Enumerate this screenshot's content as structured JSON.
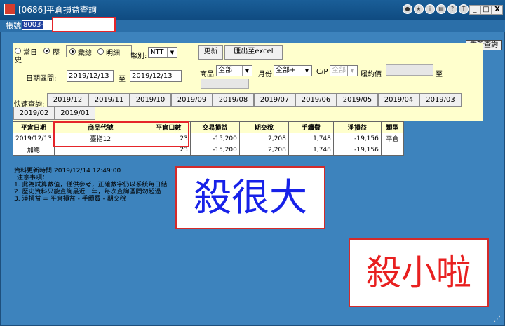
{
  "window": {
    "title": "[0686]平倉損益查詢",
    "minimize": "_",
    "maximize": "□",
    "close": "X"
  },
  "titlebar_icons": [
    "user-icon",
    "star-icon",
    "info-icon",
    "print-icon",
    "help-icon",
    "question-icon"
  ],
  "account": {
    "label": "帳號",
    "value": "8003-006"
  },
  "requery_button": "重新查詢",
  "filters": {
    "today_label": "當日",
    "history_label": "歷",
    "history_label2": "史",
    "total_label": "彙總",
    "detail_label": "明細",
    "currency_label": "幣別:",
    "currency_value": "NTT",
    "refresh_button": "更新",
    "export_button": "匯出至excel",
    "date_range_label": "日期區間:",
    "date_from": "2019/12/13",
    "date_to_label": "至",
    "date_to": "2019/12/13",
    "product_label": "商品",
    "product_value": "全部",
    "month_label": "月份",
    "month_value": "全部+",
    "cp_label": "C/P",
    "cp_value": "全部",
    "strike_label": "履約價",
    "strike_to_label": "至",
    "quick_query_label": "快速查詢:",
    "quick_months": [
      "2019/12",
      "2019/11",
      "2019/10",
      "2019/09",
      "2019/08",
      "2019/07",
      "2019/06",
      "2019/05",
      "2019/04",
      "2019/03",
      "2019/02",
      "2019/01"
    ]
  },
  "table": {
    "headers": [
      "平倉日期",
      "商品代號",
      "平倉口數",
      "交易損益",
      "期交稅",
      "手續費",
      "淨損益",
      "類型"
    ],
    "rows": [
      [
        "2019/12/13",
        "臺指12",
        "23",
        "-15,200",
        "2,208",
        "1,748",
        "-19,156",
        "平倉"
      ]
    ],
    "total_row": [
      "加總",
      "",
      "23",
      "-15,200",
      "2,208",
      "1,748",
      "-19,156",
      ""
    ]
  },
  "notes": {
    "updated": "資料更新時間:2019/12/14 12:49:00",
    "heading": "注意事項：",
    "line1": "1. 此為試算數值，僅供參考，正確數字仍以系統每日結",
    "line2": "2. 歷史資料只能查詢最近一年，每次查詢區間勿超過一",
    "line3": "3. 淨損益 = 平倉損益 - 手續費 - 期交稅"
  },
  "annotations": {
    "big": "殺很大",
    "small": "殺小啦"
  },
  "colors": {
    "background": "#3d83bd",
    "panel": "#ffffcd",
    "annotation_border": "#d42a2a",
    "big_text": "#1721e8",
    "small_text": "#e82020"
  }
}
